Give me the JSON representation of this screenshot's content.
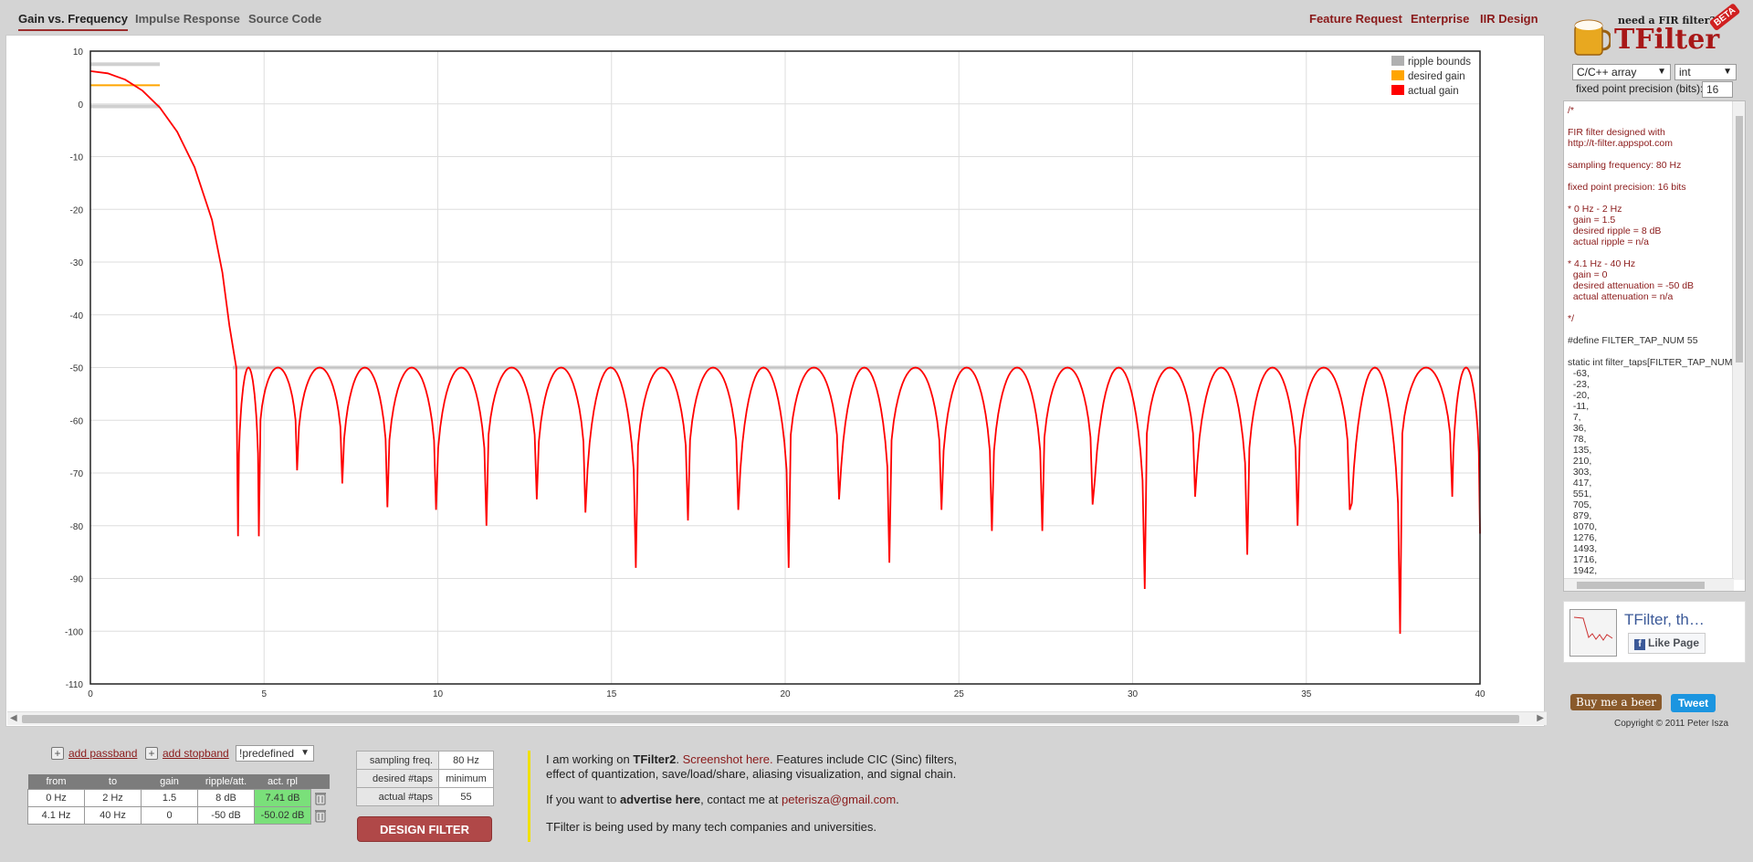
{
  "tabs": [
    {
      "label": "Gain vs. Frequency",
      "active": true
    },
    {
      "label": "Impulse Response",
      "active": false
    },
    {
      "label": "Source Code",
      "active": false
    }
  ],
  "top_links": [
    "Feature Request",
    "Enterprise",
    "IIR Design"
  ],
  "chart_data": {
    "type": "line",
    "xlim": [
      0,
      40
    ],
    "ylim": [
      -110,
      10
    ],
    "x_ticks": [
      "0",
      "5",
      "10",
      "15",
      "20",
      "25",
      "30",
      "35",
      "40"
    ],
    "y_ticks": [
      "10",
      "0",
      "-10",
      "-20",
      "-30",
      "-40",
      "-50",
      "-60",
      "-70",
      "-80",
      "-90",
      "-100",
      "-110"
    ],
    "grid": true,
    "legend_position": "top-right",
    "legend": [
      {
        "name": "ripple bounds",
        "color": "#b0b0b0"
      },
      {
        "name": "desired gain",
        "color": "#ffa500"
      },
      {
        "name": "actual gain",
        "color": "#ff0000"
      }
    ],
    "passband": {
      "from": 0,
      "to": 2,
      "desired_gain_db": 3.52,
      "ripple_upper_db": 7.52,
      "ripple_lower_db": -0.48
    },
    "stopband": {
      "from": 4.1,
      "to": 40,
      "bound_db": -50
    },
    "series": [
      {
        "name": "actual gain",
        "color": "#ff0000",
        "points": [
          [
            0,
            6.2
          ],
          [
            0.5,
            5.8
          ],
          [
            1,
            4.6
          ],
          [
            1.5,
            2.5
          ],
          [
            2,
            -0.7
          ],
          [
            2.5,
            -5.3
          ],
          [
            3,
            -12
          ],
          [
            3.5,
            -22
          ],
          [
            3.8,
            -32
          ],
          [
            4.0,
            -42
          ],
          [
            4.2,
            -50
          ],
          [
            4.25,
            -82
          ]
        ],
        "stopband_lobes": [
          {
            "x1": 4.25,
            "x2": 4.85,
            "peak": -50.0,
            "null": -82
          },
          {
            "x1": 4.85,
            "x2": 5.95,
            "peak": -50.0,
            "null": -69.5
          },
          {
            "x1": 5.95,
            "x2": 7.25,
            "peak": -50.0,
            "null": -72
          },
          {
            "x1": 7.25,
            "x2": 8.55,
            "peak": -50.0,
            "null": -76.5
          },
          {
            "x1": 8.55,
            "x2": 9.95,
            "peak": -50.0,
            "null": -77
          },
          {
            "x1": 9.95,
            "x2": 11.4,
            "peak": -50.0,
            "null": -80
          },
          {
            "x1": 11.4,
            "x2": 12.85,
            "peak": -50.0,
            "null": -75
          },
          {
            "x1": 12.85,
            "x2": 14.25,
            "peak": -50.0,
            "null": -77.5
          },
          {
            "x1": 14.25,
            "x2": 15.7,
            "peak": -50.0,
            "null": -88
          },
          {
            "x1": 15.7,
            "x2": 17.2,
            "peak": -50.0,
            "null": -79
          },
          {
            "x1": 17.2,
            "x2": 18.65,
            "peak": -50.0,
            "null": -77
          },
          {
            "x1": 18.65,
            "x2": 20.1,
            "peak": -50.0,
            "null": -88
          },
          {
            "x1": 20.1,
            "x2": 21.55,
            "peak": -50.0,
            "null": -75
          },
          {
            "x1": 21.55,
            "x2": 23.0,
            "peak": -50.0,
            "null": -87
          },
          {
            "x1": 23.0,
            "x2": 24.5,
            "peak": -50.0,
            "null": -77
          },
          {
            "x1": 24.5,
            "x2": 25.95,
            "peak": -50.0,
            "null": -81
          },
          {
            "x1": 25.95,
            "x2": 27.4,
            "peak": -50.0,
            "null": -81
          },
          {
            "x1": 27.4,
            "x2": 28.85,
            "peak": -50.0,
            "null": -76
          },
          {
            "x1": 28.85,
            "x2": 30.35,
            "peak": -50.0,
            "null": -92
          },
          {
            "x1": 30.35,
            "x2": 31.8,
            "peak": -50.0,
            "null": -74.5
          },
          {
            "x1": 31.8,
            "x2": 33.3,
            "peak": -50.0,
            "null": -85.5
          },
          {
            "x1": 33.3,
            "x2": 34.75,
            "peak": -50.0,
            "null": -80
          },
          {
            "x1": 34.75,
            "x2": 36.25,
            "peak": -50.0,
            "null": -77
          },
          {
            "x1": 36.25,
            "x2": 37.7,
            "peak": -50.0,
            "null": -100.5
          },
          {
            "x1": 37.7,
            "x2": 39.2,
            "peak": -50.0,
            "null": -74.5
          },
          {
            "x1": 39.2,
            "x2": 40.0,
            "peak": -50.0,
            "null": -81.5
          }
        ]
      }
    ]
  },
  "sidebar": {
    "logo_tagline": "need a FIR filter?",
    "logo_name": "TFilter",
    "logo_badge": "BETA",
    "format_select": "C/C++ array",
    "type_select": "int",
    "precision_label": "fixed point precision (bits):",
    "precision_value": "16",
    "code_lines": [
      {
        "t": "/*",
        "c": true
      },
      {
        "t": "",
        "c": true
      },
      {
        "t": "FIR filter designed with",
        "c": true
      },
      {
        "t": "http://t-filter.appspot.com",
        "c": true
      },
      {
        "t": "",
        "c": true
      },
      {
        "t": "sampling frequency: 80 Hz",
        "c": true
      },
      {
        "t": "",
        "c": true
      },
      {
        "t": "fixed point precision: 16 bits",
        "c": true
      },
      {
        "t": "",
        "c": true
      },
      {
        "t": "* 0 Hz - 2 Hz",
        "c": true
      },
      {
        "t": "  gain = 1.5",
        "c": true
      },
      {
        "t": "  desired ripple = 8 dB",
        "c": true
      },
      {
        "t": "  actual ripple = n/a",
        "c": true
      },
      {
        "t": "",
        "c": true
      },
      {
        "t": "* 4.1 Hz - 40 Hz",
        "c": true
      },
      {
        "t": "  gain = 0",
        "c": true
      },
      {
        "t": "  desired attenuation = -50 dB",
        "c": true
      },
      {
        "t": "  actual attenuation = n/a",
        "c": true
      },
      {
        "t": "",
        "c": true
      },
      {
        "t": "*/",
        "c": true
      },
      {
        "t": "",
        "c": false
      },
      {
        "t": "#define FILTER_TAP_NUM 55",
        "c": false
      },
      {
        "t": "",
        "c": false
      },
      {
        "t": "static int filter_taps[FILTER_TAP_NUM] = {",
        "c": false
      },
      {
        "t": "  -63,",
        "c": false
      },
      {
        "t": "  -23,",
        "c": false
      },
      {
        "t": "  -20,",
        "c": false
      },
      {
        "t": "  -11,",
        "c": false
      },
      {
        "t": "  7,",
        "c": false
      },
      {
        "t": "  36,",
        "c": false
      },
      {
        "t": "  78,",
        "c": false
      },
      {
        "t": "  135,",
        "c": false
      },
      {
        "t": "  210,",
        "c": false
      },
      {
        "t": "  303,",
        "c": false
      },
      {
        "t": "  417,",
        "c": false
      },
      {
        "t": "  551,",
        "c": false
      },
      {
        "t": "  705,",
        "c": false
      },
      {
        "t": "  879,",
        "c": false
      },
      {
        "t": "  1070,",
        "c": false
      },
      {
        "t": "  1276,",
        "c": false
      },
      {
        "t": "  1493,",
        "c": false
      },
      {
        "t": "  1716,",
        "c": false
      },
      {
        "t": "  1942,",
        "c": false
      }
    ],
    "fb_title": "TFilter, th…",
    "fb_like": "Like Page",
    "beer_button": "Buy me a beer",
    "tweet_button": "Tweet",
    "copyright": "Copyright © 2011 Peter Isza"
  },
  "bottom": {
    "add_passband": "add passband",
    "add_stopband": "add stopband",
    "predefined": "!predefined",
    "band_headers": [
      "from",
      "to",
      "gain",
      "ripple/att.",
      "act. rpl"
    ],
    "bands": [
      {
        "from": "0 Hz",
        "to": "2 Hz",
        "gain": "1.5",
        "ripple": "8 dB",
        "act": "7.41 dB"
      },
      {
        "from": "4.1 Hz",
        "to": "40 Hz",
        "gain": "0",
        "ripple": "-50 dB",
        "act": "-50.02 dB"
      }
    ],
    "params": [
      {
        "label": "sampling freq.",
        "value": "80 Hz"
      },
      {
        "label": "desired #taps",
        "value": "minimum"
      },
      {
        "label": "actual #taps",
        "value": "55"
      }
    ],
    "design_button": "DESIGN FILTER",
    "info": {
      "l1a": "I am working on ",
      "l1b": "TFilter2",
      "l1c": ". ",
      "l1d": "Screenshot here.",
      "l1e": " Features include CIC (Sinc) filters,",
      "l2": "effect of quantization, save/load/share, aliasing visualization, and signal chain.",
      "l3a": "If you want to ",
      "l3b": "advertise here",
      "l3c": ", contact me at ",
      "l3d": "peterisza@gmail.com",
      "l3e": ".",
      "l4": "TFilter is being used by many tech companies and universities."
    }
  }
}
